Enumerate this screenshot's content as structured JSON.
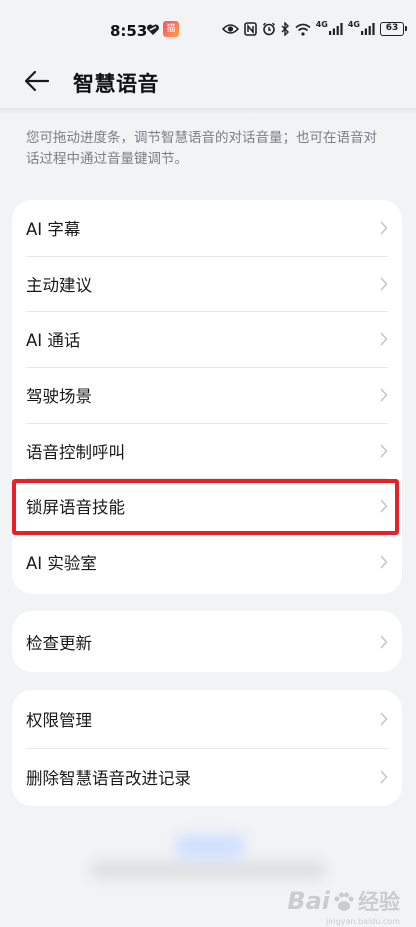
{
  "status_bar": {
    "time": "8:53",
    "app_badge": "猫",
    "network_1": "4G",
    "network_2": "4G",
    "battery": "63"
  },
  "header": {
    "title": "智慧语音",
    "back_icon": "arrow-left-icon"
  },
  "description": "您可拖动进度条，调节智慧语音的对话音量；也可在语音对话过程中通过音量键调节。",
  "settings_group_1": [
    {
      "label": "AI 字幕"
    },
    {
      "label": "主动建议"
    },
    {
      "label": "AI 通话"
    },
    {
      "label": "驾驶场景"
    },
    {
      "label": "语音控制呼叫"
    },
    {
      "label": "锁屏语音技能"
    },
    {
      "label": "AI 实验室"
    }
  ],
  "settings_group_2": [
    {
      "label": "检查更新"
    }
  ],
  "settings_group_3": [
    {
      "label": "权限管理"
    },
    {
      "label": "删除智慧语音改进记录"
    }
  ],
  "highlight_color": "#e8202a",
  "watermark": {
    "main": "Bai",
    "sub": "经验",
    "url": "jingyan.baidu.com"
  }
}
